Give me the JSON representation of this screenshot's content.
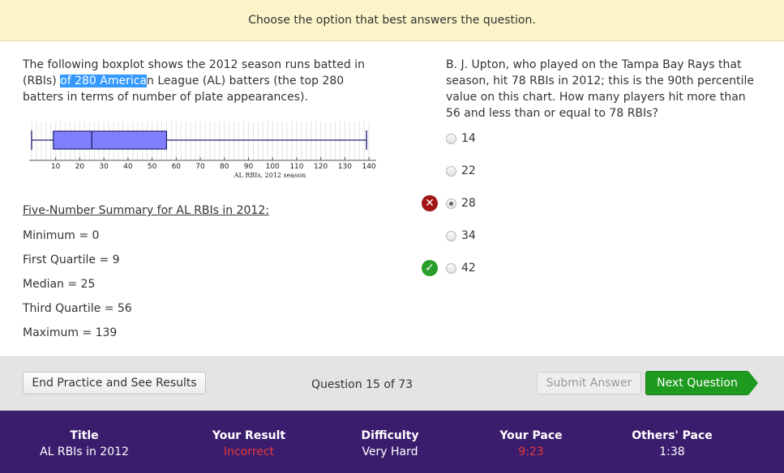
{
  "banner": "Choose the option that best answers the question.",
  "question_left": {
    "intro_before": "The following boxplot shows the 2012 season runs batted in (RBIs) ",
    "intro_highlight": "of 280 America",
    "intro_after": "n League (AL) batters (the top 280 batters in terms of number of plate appearances)."
  },
  "chart_data": {
    "type": "boxplot",
    "min": 0,
    "q1": 9,
    "median": 25,
    "q3": 56,
    "max": 139,
    "ticks": [
      "10",
      "20",
      "30",
      "40",
      "50",
      "60",
      "70",
      "80",
      "90",
      "100",
      "110",
      "120",
      "130",
      "140"
    ],
    "xlabel": "AL RBIs, 2012 season",
    "xlim": [
      -1,
      143
    ],
    "box_color": "#8080ff"
  },
  "summary": {
    "title": "Five-Number Summary for AL RBIs in 2012:",
    "min": "Minimum = 0",
    "q1": "First Quartile = 9",
    "median": "Median = 25",
    "q3": "Third Quartile = 56",
    "max": "Maximum = 139"
  },
  "question_right": "B. J. Upton, who played on the Tampa Bay Rays that season, hit 78 RBIs in 2012; this is the 90th percentile value on this chart. How many players hit more than 56 and less than or equal to 78 RBIs?",
  "options": [
    "14",
    "22",
    "28",
    "34",
    "42"
  ],
  "selected_option": "28",
  "correct_option": "42",
  "buttons": {
    "end": "End Practice and See Results",
    "submit": "Submit Answer",
    "next": "Next Question"
  },
  "question_counter": "Question 15 of 73",
  "footer": {
    "title_label": "Title",
    "title_value": "AL RBIs in 2012",
    "result_label": "Your Result",
    "result_value": "Incorrect",
    "difficulty_label": "Difficulty",
    "difficulty_value": "Very Hard",
    "pace_label": "Your Pace",
    "pace_value": "9:23",
    "others_label": "Others' Pace",
    "others_value": "1:38"
  }
}
